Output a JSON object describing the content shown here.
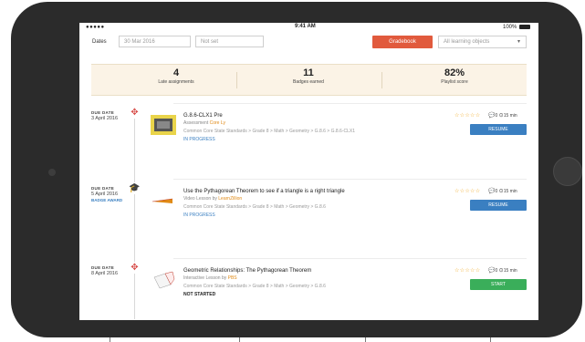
{
  "status_bar": {
    "signal": "●●●●● ",
    "time": "9:41 AM",
    "battery": "100%"
  },
  "filters": {
    "dates_label": "Dates",
    "start_date": "30 Mar 2016",
    "end_date": "Not set",
    "gradebook_label": "Gradebook",
    "objectives_label": "All learning objects"
  },
  "stats": [
    {
      "value": "4",
      "label": "Late assignments"
    },
    {
      "value": "11",
      "label": "Badges earned"
    },
    {
      "value": "82%",
      "label": "Playlist score"
    }
  ],
  "assignments": [
    {
      "due_label": "DUE DATE",
      "due_date": "3 April 2016",
      "badge": "",
      "title": "G.8.6-CLX1 Pre",
      "type_text": "Assessment ",
      "org": "Core Ly",
      "path": "Common Core State Standards > Grade 8 > Math > Geometry > G.8.6 > G.8.6-CLX1",
      "status": "IN PROGRESS",
      "stars": "☆☆☆☆☆",
      "comments": "0",
      "duration": "15 min",
      "action": "RESUME",
      "action_color": "#3a7fc1"
    },
    {
      "due_label": "DUE DATE",
      "due_date": "5 April 2016",
      "badge": "BADGE AWARD",
      "title": "Use the Pythagorean Theorem to see if a triangle is a right triangle",
      "type_text": "Video Lesson by ",
      "org": "LearnZillion",
      "path": "Common Core State Standards > Grade 8 > Math > Geometry > G.8.6",
      "status": "IN PROGRESS",
      "stars": "☆☆☆☆☆",
      "comments": "0",
      "duration": "15 min",
      "action": "RESUME",
      "action_color": "#3a7fc1"
    },
    {
      "due_label": "DUE DATE",
      "due_date": "8 April 2016",
      "badge": "",
      "title": "Geometric Relationships: The Pythagorean Theorem",
      "type_text": "Interactive Lesson by ",
      "org": "PBS",
      "path": "Common Core State Standards > Grade 8 > Math > Geometry > G.8.6",
      "status": "NOT STARTED",
      "stars": "☆☆☆☆☆",
      "comments": "0",
      "duration": "15 min",
      "action": "START",
      "action_color": "#3aae5a"
    }
  ]
}
